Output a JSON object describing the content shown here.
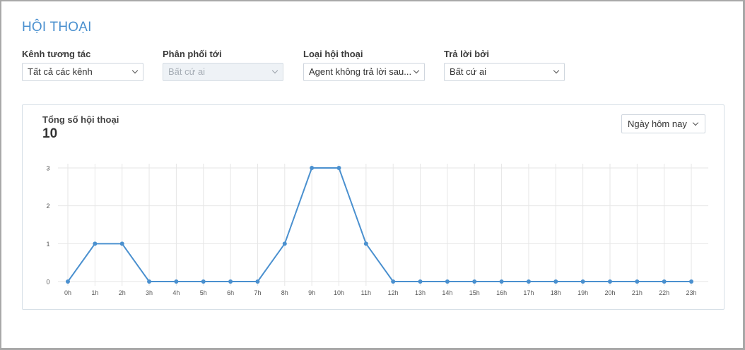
{
  "page": {
    "title": "HỘI THOẠI"
  },
  "filters": [
    {
      "label": "Kênh tương tác",
      "value": "Tất cả các kênh",
      "disabled": false
    },
    {
      "label": "Phân phối tới",
      "value": "Bất cứ ai",
      "disabled": true
    },
    {
      "label": "Loại hội thoại",
      "value": "Agent không trả lời sau...",
      "disabled": false
    },
    {
      "label": "Trả lời bởi",
      "value": "Bất cứ ai",
      "disabled": false
    }
  ],
  "card": {
    "title": "Tổng số hội thoại",
    "count": "10",
    "range": "Ngày hôm nay"
  },
  "chart_data": {
    "type": "line",
    "categories": [
      "0h",
      "1h",
      "2h",
      "3h",
      "4h",
      "5h",
      "6h",
      "7h",
      "8h",
      "9h",
      "10h",
      "11h",
      "12h",
      "13h",
      "14h",
      "15h",
      "16h",
      "17h",
      "18h",
      "19h",
      "20h",
      "21h",
      "22h",
      "23h"
    ],
    "values": [
      0,
      1,
      1,
      0,
      0,
      0,
      0,
      0,
      1,
      3,
      3,
      1,
      0,
      0,
      0,
      0,
      0,
      0,
      0,
      0,
      0,
      0,
      0,
      0
    ],
    "yticks": [
      0,
      1,
      2,
      3
    ],
    "ylim": [
      0,
      3
    ],
    "grid": true,
    "color": "#4a90cf"
  }
}
